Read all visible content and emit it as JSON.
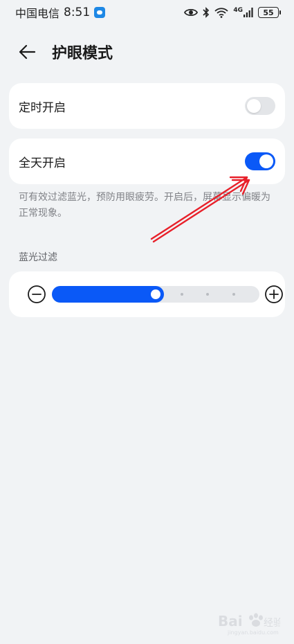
{
  "status_bar": {
    "carrier": "中国电信",
    "time": "8:51",
    "network": "4G",
    "battery": "55"
  },
  "header": {
    "title": "护眼模式"
  },
  "settings": {
    "scheduled": {
      "label": "定时开启",
      "enabled": false
    },
    "all_day": {
      "label": "全天开启",
      "enabled": true
    }
  },
  "description": "可有效过滤蓝光，预防用眼疲劳。开启后，屏幕显示偏暖为正常现象。",
  "blue_light_filter": {
    "label": "蓝光过滤",
    "level": 0.5,
    "steps": 8
  },
  "colors": {
    "accent": "#0a59f7",
    "background": "#f1f3f5",
    "annotation": "#e8202a"
  },
  "icons": {
    "back": "back-arrow-icon",
    "decrease": "minus-circle-icon",
    "increase": "plus-circle-icon"
  }
}
